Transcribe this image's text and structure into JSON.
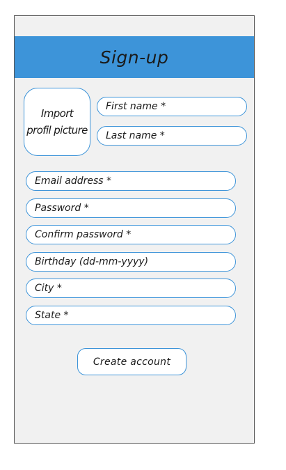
{
  "header": {
    "title": "Sign-up"
  },
  "profile_picture": {
    "line1": "Import",
    "line2": "profil picture"
  },
  "fields": {
    "first_name": "First name *",
    "last_name": "Last name *",
    "email": "Email address *",
    "password": "Password *",
    "confirm_password": "Confirm password *",
    "birthday": "Birthday (dd-mm-yyyy)",
    "city": "City *",
    "state": "State *"
  },
  "actions": {
    "create_account": "Create account"
  },
  "colors": {
    "accent": "#3d94d9",
    "panel_background": "#f1f1f1",
    "field_background": "#ffffff",
    "text": "#1a1a1a"
  }
}
